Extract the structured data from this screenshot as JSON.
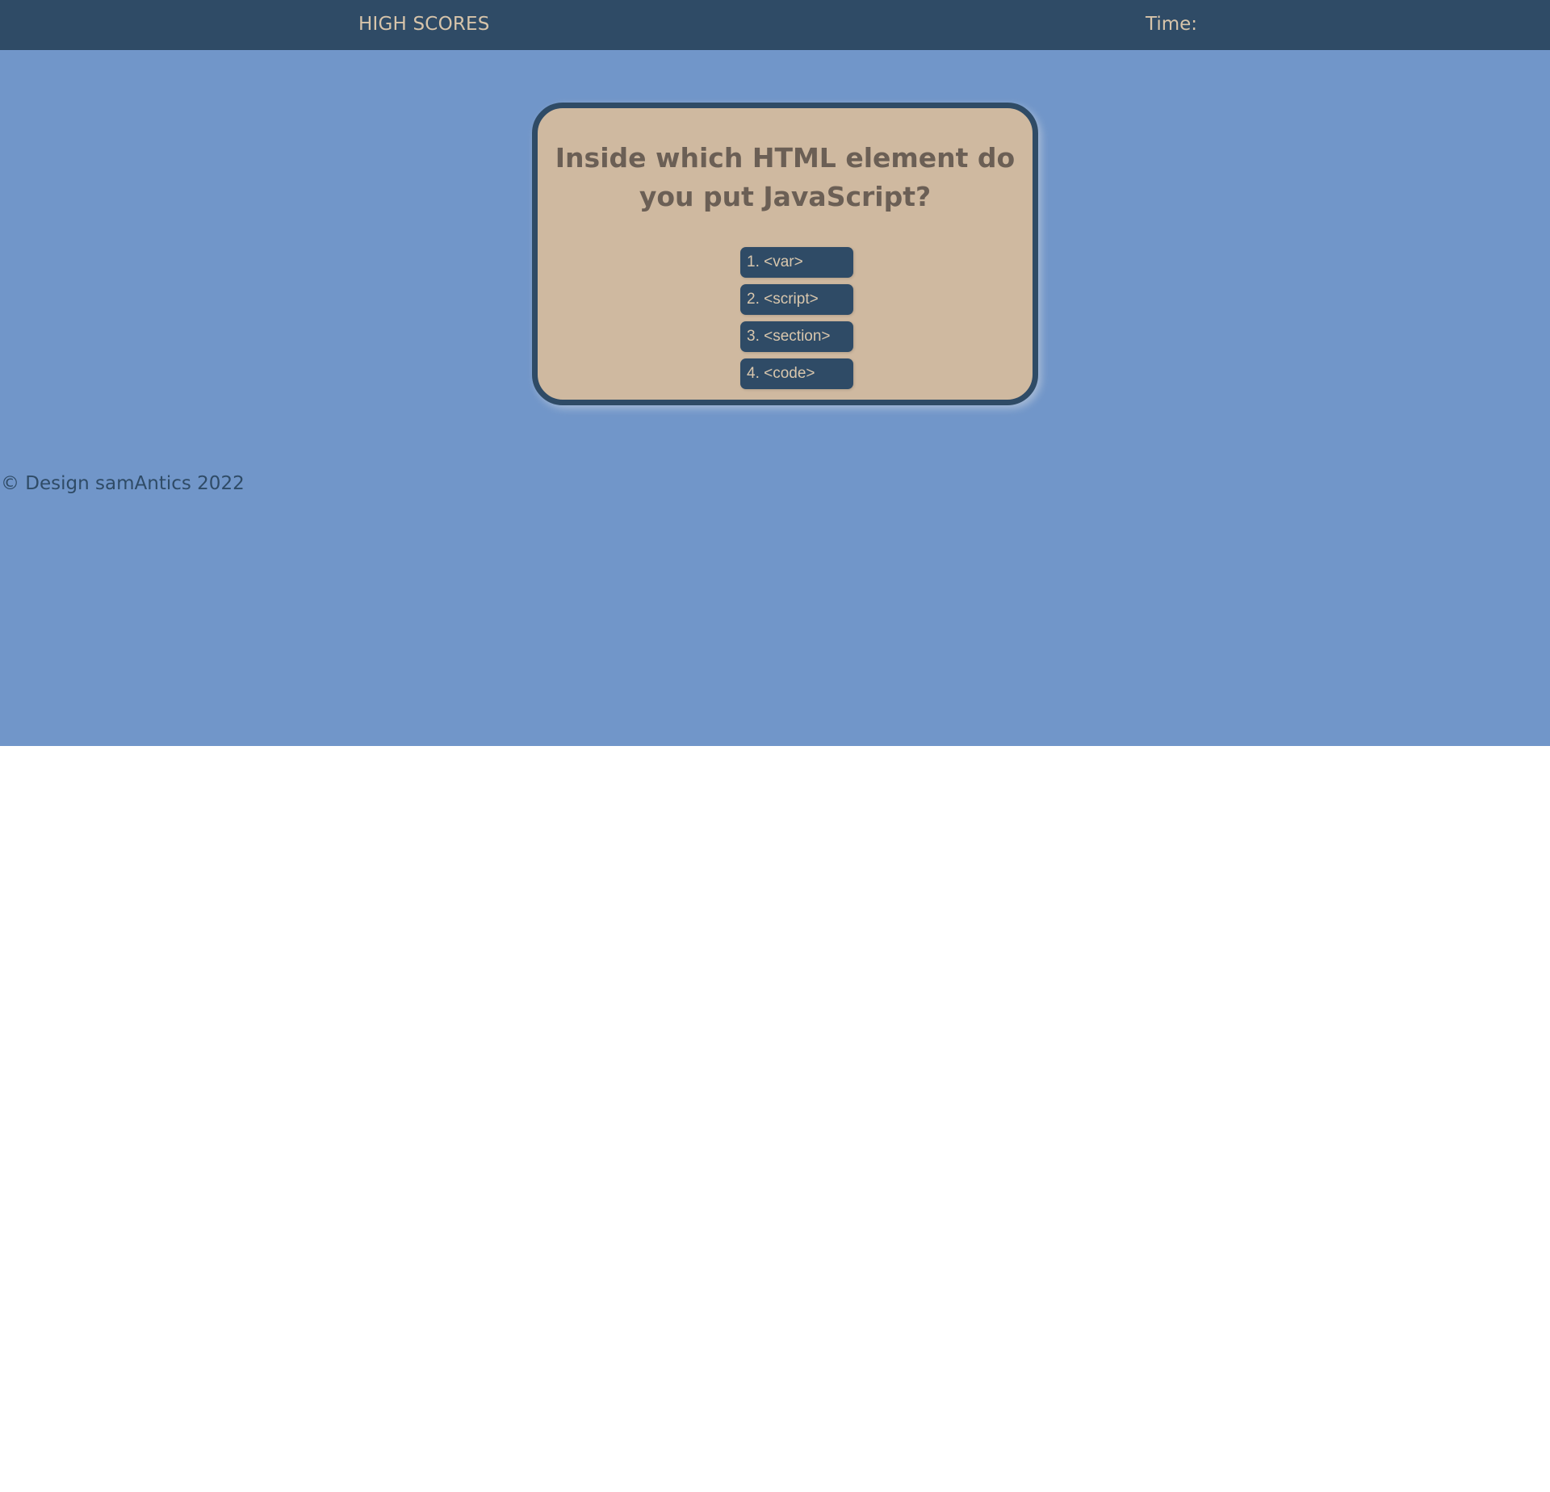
{
  "header": {
    "high_scores_label": "HIGH SCORES",
    "timer_label": "Time:",
    "timer_value": ""
  },
  "quiz": {
    "question": "Inside which HTML element do you put JavaScript?",
    "choices": [
      {
        "label": "1. <var>"
      },
      {
        "label": "2. <script>"
      },
      {
        "label": "3. <section>"
      },
      {
        "label": "4. <code>"
      }
    ]
  },
  "footer": {
    "text": "© Design samAntics 2022"
  },
  "colors": {
    "header_bg": "#2f4b66",
    "page_bg": "#7196c9",
    "card_bg": "#cfb9a0",
    "accent_text": "#d7c4aa",
    "question_text": "#6b5f55"
  }
}
